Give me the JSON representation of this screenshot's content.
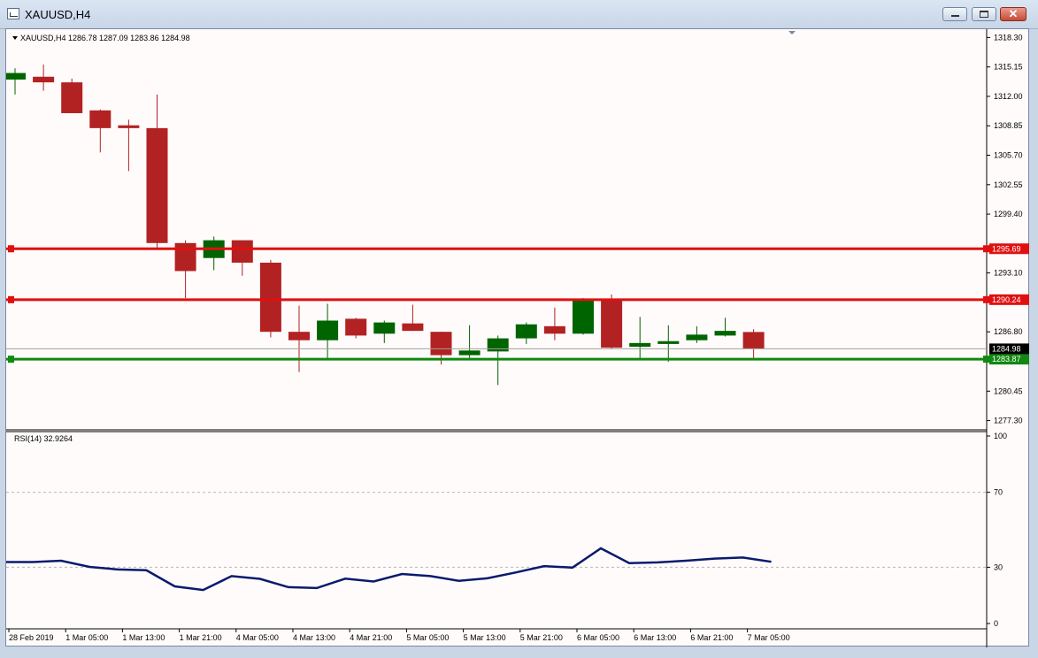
{
  "window": {
    "title": "XAUUSD,H4",
    "buttons": [
      "minimize",
      "maximize",
      "close"
    ]
  },
  "colors": {
    "bull": "#006400",
    "bear": "#b22222",
    "resistance_line": "#e01010",
    "support_line": "#118811",
    "rsi_line": "#0a1a6e",
    "background": "#fffbfb"
  },
  "main_panel": {
    "header": "XAUUSD,H4  1286.78 1287.09 1283.86 1284.98",
    "price_ticks": [
      "1318.30",
      "1315.15",
      "1312.00",
      "1308.85",
      "1305.70",
      "1302.55",
      "1299.40",
      "1293.10",
      "1286.80",
      "1280.45",
      "1277.30"
    ],
    "lines": [
      {
        "price": 1295.69,
        "label": "1295.69",
        "kind": "resistance"
      },
      {
        "price": 1290.24,
        "label": "1290.24",
        "kind": "resistance"
      },
      {
        "price": 1283.87,
        "label": "1283.87",
        "kind": "support"
      }
    ],
    "current_price": {
      "price": 1284.98,
      "label": "1284.98"
    }
  },
  "rsi_panel": {
    "header": "RSI(14) 32.9264",
    "levels": [
      "100",
      "70",
      "30",
      "0"
    ]
  },
  "time_axis": [
    "28 Feb 2019",
    "1 Mar 05:00",
    "1 Mar 13:00",
    "1 Mar 21:00",
    "4 Mar 05:00",
    "4 Mar 13:00",
    "4 Mar 21:00",
    "5 Mar 05:00",
    "5 Mar 13:00",
    "5 Mar 21:00",
    "6 Mar 05:00",
    "6 Mar 13:00",
    "6 Mar 21:00",
    "7 Mar 05:00"
  ],
  "chart_data": {
    "type": "candlestick",
    "symbol": "XAUUSD",
    "timeframe": "H4",
    "ylim": [
      1276.5,
      1319.0
    ],
    "candles": [
      {
        "o": 1313.8,
        "h": 1315.0,
        "l": 1312.2,
        "c": 1314.5
      },
      {
        "o": 1314.1,
        "h": 1315.4,
        "l": 1312.6,
        "c": 1313.5
      },
      {
        "o": 1313.5,
        "h": 1313.9,
        "l": 1310.2,
        "c": 1310.2
      },
      {
        "o": 1310.5,
        "h": 1310.6,
        "l": 1306.0,
        "c": 1308.6
      },
      {
        "o": 1308.9,
        "h": 1309.5,
        "l": 1304.0,
        "c": 1308.6
      },
      {
        "o": 1308.6,
        "h": 1312.2,
        "l": 1295.8,
        "c": 1296.3
      },
      {
        "o": 1296.3,
        "h": 1296.6,
        "l": 1290.4,
        "c": 1293.3
      },
      {
        "o": 1294.7,
        "h": 1297.0,
        "l": 1293.4,
        "c": 1296.6
      },
      {
        "o": 1296.6,
        "h": 1296.6,
        "l": 1292.8,
        "c": 1294.2
      },
      {
        "o": 1294.2,
        "h": 1294.5,
        "l": 1286.2,
        "c": 1286.8
      },
      {
        "o": 1286.8,
        "h": 1289.6,
        "l": 1282.5,
        "c": 1285.9
      },
      {
        "o": 1285.9,
        "h": 1289.8,
        "l": 1283.8,
        "c": 1288.0
      },
      {
        "o": 1288.2,
        "h": 1288.3,
        "l": 1286.1,
        "c": 1286.4
      },
      {
        "o": 1286.6,
        "h": 1288.0,
        "l": 1285.6,
        "c": 1287.8
      },
      {
        "o": 1287.7,
        "h": 1289.7,
        "l": 1286.9,
        "c": 1286.9
      },
      {
        "o": 1286.8,
        "h": 1286.8,
        "l": 1283.3,
        "c": 1284.3
      },
      {
        "o": 1284.3,
        "h": 1287.5,
        "l": 1284.0,
        "c": 1284.8
      },
      {
        "o": 1284.7,
        "h": 1286.4,
        "l": 1281.1,
        "c": 1286.1
      },
      {
        "o": 1286.1,
        "h": 1287.8,
        "l": 1285.5,
        "c": 1287.6
      },
      {
        "o": 1287.4,
        "h": 1289.4,
        "l": 1285.9,
        "c": 1286.6
      },
      {
        "o": 1286.6,
        "h": 1290.4,
        "l": 1286.5,
        "c": 1290.3
      },
      {
        "o": 1290.3,
        "h": 1290.8,
        "l": 1285.0,
        "c": 1285.1
      },
      {
        "o": 1285.2,
        "h": 1288.4,
        "l": 1283.9,
        "c": 1285.6
      },
      {
        "o": 1285.5,
        "h": 1287.5,
        "l": 1283.6,
        "c": 1285.8
      },
      {
        "o": 1285.9,
        "h": 1287.4,
        "l": 1285.6,
        "c": 1286.5
      },
      {
        "o": 1286.4,
        "h": 1288.3,
        "l": 1286.3,
        "c": 1286.9
      },
      {
        "o": 1286.78,
        "h": 1287.09,
        "l": 1283.86,
        "c": 1284.98
      }
    ],
    "rsi": {
      "name": "RSI(14)",
      "period": 14,
      "ylim": [
        0,
        100
      ],
      "levels": [
        70,
        30
      ],
      "values": [
        32.8,
        33.5,
        30.2,
        28.8,
        28.4,
        19.8,
        17.9,
        25.3,
        23.8,
        19.4,
        18.9,
        23.9,
        22.4,
        26.4,
        25.3,
        22.8,
        24.1,
        27.2,
        30.6,
        29.8,
        40.1,
        32.2,
        32.6,
        33.5,
        34.6,
        35.2,
        32.9264
      ]
    }
  }
}
